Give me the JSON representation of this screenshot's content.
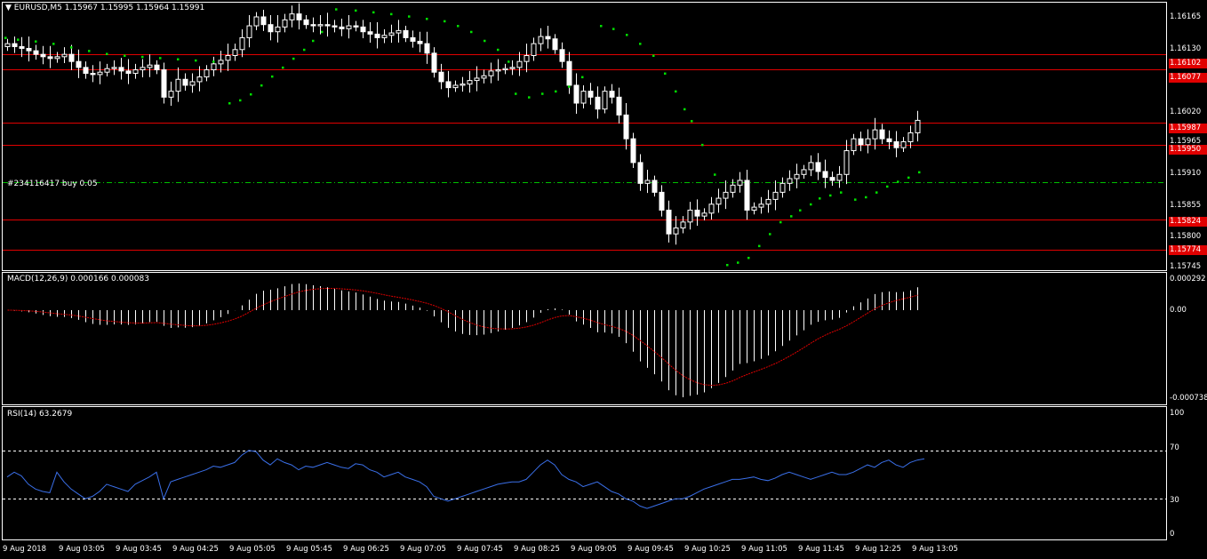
{
  "header": {
    "symbol": "EURUSD,M5",
    "ohlc": "1.15967 1.15995 1.15964 1.15991"
  },
  "order_line": {
    "label": "#234116417 buy 0.05",
    "price": 1.15887,
    "color": "#00c000"
  },
  "price_axis": {
    "ticks": [
      {
        "label": "1.16165",
        "value": 1.16165
      },
      {
        "label": "1.16130",
        "value": 1.1613
      },
      {
        "label": "1.16020",
        "value": 1.1602
      },
      {
        "label": "1.15965",
        "value": 1.15965
      },
      {
        "label": "1.15910",
        "value": 1.1591
      },
      {
        "label": "1.15855",
        "value": 1.15855
      },
      {
        "label": "1.15800",
        "value": 1.158
      },
      {
        "label": "1.15745",
        "value": 1.15745
      }
    ]
  },
  "level_lines": [
    {
      "label": "1.16102",
      "value": 1.16102
    },
    {
      "label": "1.16077",
      "value": 1.16077
    },
    {
      "label": "1.15987",
      "value": 1.15987
    },
    {
      "label": "1.15950",
      "value": 1.1595
    },
    {
      "label": "1.15824",
      "value": 1.15824
    },
    {
      "label": "1.15774",
      "value": 1.15774
    }
  ],
  "macd": {
    "label": "MACD(12,26,9) 0.000166 0.000083",
    "axis": [
      {
        "label": "0.000292",
        "value": 0.000292
      },
      {
        "label": "0.00",
        "value": 0
      },
      {
        "label": "-0.000738",
        "value": -0.000738
      }
    ]
  },
  "rsi": {
    "label": "RSI(14) 63.2679",
    "axis": [
      {
        "label": "100",
        "value": 100
      },
      {
        "label": "70",
        "value": 70
      },
      {
        "label": "30",
        "value": 30
      },
      {
        "label": "0",
        "value": 0
      }
    ]
  },
  "time_axis": [
    "9 Aug 2018",
    "9 Aug 03:05",
    "9 Aug 03:45",
    "9 Aug 04:25",
    "9 Aug 05:05",
    "9 Aug 05:45",
    "9 Aug 06:25",
    "9 Aug 07:05",
    "9 Aug 07:45",
    "9 Aug 08:25",
    "9 Aug 09:05",
    "9 Aug 09:45",
    "9 Aug 10:25",
    "9 Aug 11:05",
    "9 Aug 11:45",
    "9 Aug 12:25",
    "9 Aug 13:05"
  ],
  "colors": {
    "background": "#000000",
    "bull_candle": "#ffffff",
    "bear_candle": "#ffffff",
    "level_line": "#e00000",
    "sar": "#00e000",
    "macd_signal": "#e00000",
    "rsi_line": "#3a6fe8",
    "grid_text": "#ffffff"
  },
  "chart_data": {
    "type": "candlestick",
    "close_path": [
      1.1612,
      1.16115,
      1.16112,
      1.16108,
      1.16102,
      1.16098,
      1.16095,
      1.16098,
      1.16102,
      1.1609,
      1.1608,
      1.1607,
      1.16068,
      1.16072,
      1.16078,
      1.1608,
      1.16074,
      1.1607,
      1.16076,
      1.1608,
      1.16084,
      1.16076,
      1.1603,
      1.1604,
      1.1606,
      1.1605,
      1.16056,
      1.16064,
      1.16076,
      1.16086,
      1.16092,
      1.161,
      1.1611,
      1.1613,
      1.1615,
      1.16165,
      1.16152,
      1.1614,
      1.16148,
      1.1616,
      1.1617,
      1.1616,
      1.16152,
      1.1615,
      1.16152,
      1.1615,
      1.16148,
      1.16145,
      1.1615,
      1.16148,
      1.1614,
      1.16136,
      1.1613,
      1.16134,
      1.16138,
      1.16142,
      1.1613,
      1.16124,
      1.1612,
      1.16104,
      1.16072,
      1.16056,
      1.16046,
      1.1605,
      1.16052,
      1.16058,
      1.16062,
      1.16066,
      1.16074,
      1.16076,
      1.16078,
      1.1608,
      1.1609,
      1.161,
      1.1612,
      1.16132,
      1.16128,
      1.1611,
      1.1609,
      1.1605,
      1.1602,
      1.1604,
      1.1603,
      1.1601,
      1.1604,
      1.1603,
      1.16,
      1.1596,
      1.1592,
      1.15885,
      1.1589,
      1.1587,
      1.1584,
      1.158,
      1.1581,
      1.1582,
      1.1584,
      1.1583,
      1.15835,
      1.1585,
      1.1586,
      1.1587,
      1.15882,
      1.1589,
      1.1584,
      1.15845,
      1.1585,
      1.15858,
      1.1587,
      1.15885,
      1.15893,
      1.159,
      1.15908,
      1.1592,
      1.15905,
      1.15895,
      1.1589,
      1.159,
      1.1594,
      1.1596,
      1.1595,
      1.1596,
      1.15975,
      1.1596,
      1.15955,
      1.15945,
      1.15955,
      1.1597,
      1.15991
    ],
    "sar_points": [
      [
        6,
        1.1613
      ],
      [
        20,
        1.16127
      ],
      [
        40,
        1.16124
      ],
      [
        60,
        1.1612
      ],
      [
        80,
        1.16114
      ],
      [
        100,
        1.16108
      ],
      [
        120,
        1.16103
      ],
      [
        140,
        1.161
      ],
      [
        160,
        1.16098
      ],
      [
        180,
        1.16096
      ],
      [
        200,
        1.16094
      ],
      [
        220,
        1.16092
      ],
      [
        240,
        1.1609
      ],
      [
        258,
        1.1602
      ],
      [
        270,
        1.16025
      ],
      [
        282,
        1.16035
      ],
      [
        294,
        1.1605
      ],
      [
        306,
        1.16065
      ],
      [
        318,
        1.1608
      ],
      [
        330,
        1.16095
      ],
      [
        342,
        1.1611
      ],
      [
        352,
        1.16125
      ],
      [
        362,
        1.1614
      ],
      [
        378,
        1.16178
      ],
      [
        400,
        1.16176
      ],
      [
        420,
        1.16173
      ],
      [
        440,
        1.1617
      ],
      [
        460,
        1.16166
      ],
      [
        480,
        1.16162
      ],
      [
        500,
        1.16158
      ],
      [
        515,
        1.1615
      ],
      [
        530,
        1.1614
      ],
      [
        545,
        1.16125
      ],
      [
        560,
        1.1611
      ],
      [
        572,
        1.1609
      ],
      [
        580,
        1.16036
      ],
      [
        595,
        1.1603
      ],
      [
        610,
        1.16036
      ],
      [
        625,
        1.1604
      ],
      [
        640,
        1.16048
      ],
      [
        655,
        1.16064
      ],
      [
        676,
        1.1615
      ],
      [
        690,
        1.16145
      ],
      [
        705,
        1.16135
      ],
      [
        720,
        1.1612
      ],
      [
        735,
        1.161
      ],
      [
        748,
        1.1607
      ],
      [
        760,
        1.1604
      ],
      [
        770,
        1.1601
      ],
      [
        778,
        1.1599
      ],
      [
        790,
        1.1595
      ],
      [
        804,
        1.159
      ],
      [
        818,
        1.15748
      ],
      [
        830,
        1.15752
      ],
      [
        842,
        1.1576
      ],
      [
        854,
        1.1578
      ],
      [
        866,
        1.158
      ],
      [
        878,
        1.1582
      ],
      [
        890,
        1.1583
      ],
      [
        900,
        1.1584
      ],
      [
        912,
        1.1585
      ],
      [
        922,
        1.1586
      ],
      [
        934,
        1.15865
      ],
      [
        946,
        1.1587
      ],
      [
        962,
        1.15858
      ],
      [
        974,
        1.15862
      ],
      [
        986,
        1.1587
      ],
      [
        998,
        1.1588
      ],
      [
        1010,
        1.15888
      ],
      [
        1022,
        1.15895
      ],
      [
        1034,
        1.15904
      ]
    ],
    "macd_hist_range": [
      -0.000738,
      0.000292
    ],
    "rsi_levels": [
      30,
      70
    ],
    "rsi_values": [
      48,
      52,
      49,
      42,
      38,
      36,
      35,
      52,
      44,
      38,
      34,
      30,
      32,
      36,
      42,
      40,
      38,
      36,
      42,
      45,
      48,
      52,
      30,
      44,
      46,
      48,
      50,
      52,
      54,
      57,
      56,
      58,
      60,
      66,
      70,
      69,
      62,
      58,
      63,
      60,
      58,
      54,
      57,
      56,
      58,
      60,
      58,
      56,
      55,
      59,
      58,
      54,
      52,
      48,
      50,
      52,
      48,
      46,
      44,
      40,
      32,
      30,
      28,
      30,
      32,
      34,
      36,
      38,
      40,
      42,
      43,
      44,
      44,
      46,
      52,
      58,
      62,
      58,
      50,
      46,
      44,
      40,
      42,
      44,
      40,
      36,
      34,
      30,
      28,
      24,
      22,
      24,
      26,
      28,
      30,
      30,
      32,
      35,
      38,
      40,
      42,
      44,
      46,
      46,
      47,
      48,
      46,
      45,
      47,
      50,
      52,
      50,
      48,
      46,
      48,
      50,
      52,
      50,
      50,
      52,
      55,
      58,
      56,
      60,
      62,
      58,
      56,
      60,
      62,
      63
    ]
  }
}
